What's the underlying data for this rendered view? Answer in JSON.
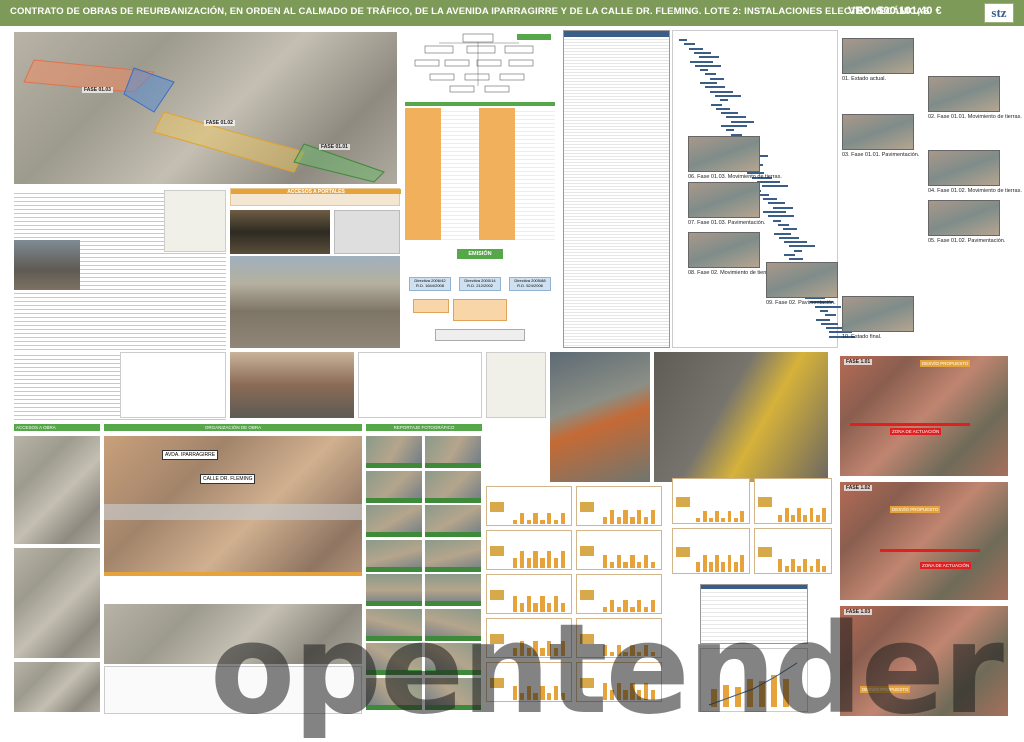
{
  "header": {
    "title": "CONTRATO DE OBRAS DE REURBANIZACIÓN, EN ORDEN AL CALMADO DE TRÁFICO, DE LA AVENIDA IPARRAGIRRE Y DE LA CALLE DR. FLEMING. LOTE 2: INSTALACIONES ELECTROMECÁNICAS",
    "vec": "VEC: 500.101,40 €",
    "logo": "stz"
  },
  "map_phases": [
    "FASE 01.03",
    "FASE 01.02",
    "FASE 01.01"
  ],
  "emision": {
    "title": "EMISIÓN",
    "directives": [
      "Directiva 2006/42\nR.D. 1644/2008",
      "Directiva 2000/14\nR.D. 212/2002",
      "Directiva 2005/88\nR.D. 524/2006"
    ]
  },
  "access_title": "ACCESOS A PORTALES",
  "organizacion_title": "ORGANIZACIÓN DE OBRA",
  "reportaje_title": "REPORTAJE FOTOGRÁFICO",
  "accesos_title": "ACCESOS A OBRA",
  "street_labels": [
    "CALLE DR. FLEMING",
    "AVDA. IPARRAGIRRE"
  ],
  "gantt_captions": [
    "01. Estado actual.",
    "02. Fase 01.01. Movimiento de tierras.",
    "03. Fase 01.01. Pavimentación.",
    "04. Fase 01.02. Movimiento de tierras.",
    "05. Fase 01.02. Pavimentación.",
    "06. Fase 01.03. Movimiento de tierras.",
    "07. Fase 01.03. Pavimentación.",
    "08. Fase 02. Movimiento de tierras.",
    "09. Fase 02. Pavimentación.",
    "10. Estado final."
  ],
  "right_maps": [
    "FASE 1.01",
    "FASE 1.02",
    "FASE 1.03"
  ],
  "right_labels": [
    "ZONA DE ACTUACIÓN",
    "DESVÍO PROPUESTO"
  ],
  "watermark": "opentender"
}
